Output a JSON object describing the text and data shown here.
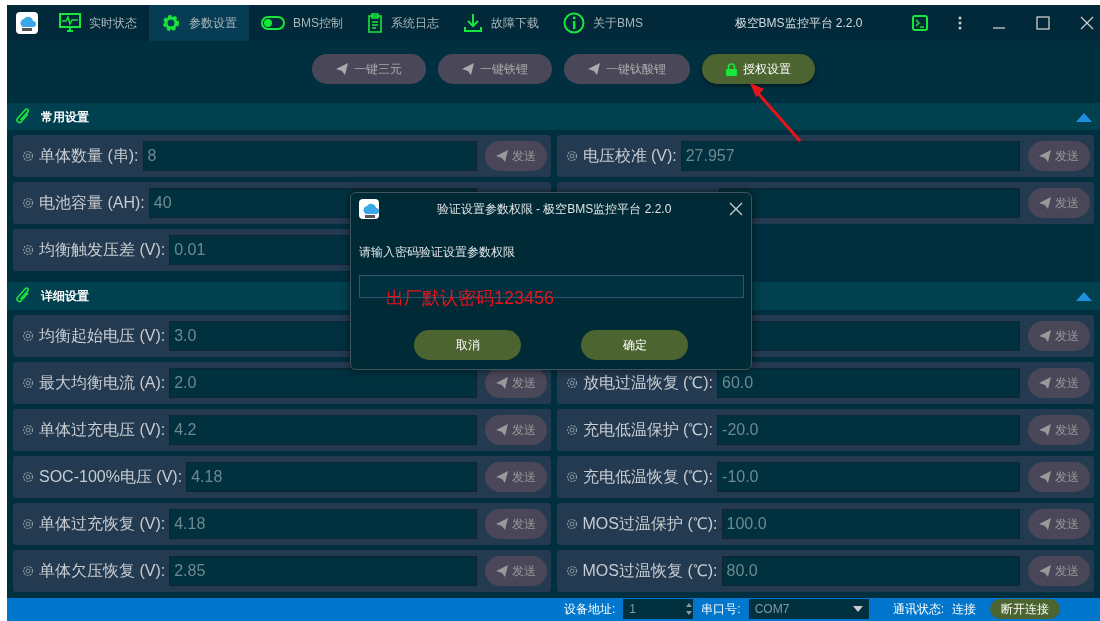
{
  "window": {
    "title": "极空BMS监控平台 2.2.0"
  },
  "tabs": [
    {
      "label": "实时状态",
      "selected": false
    },
    {
      "label": "参数设置",
      "selected": true
    },
    {
      "label": "BMS控制",
      "selected": false
    },
    {
      "label": "系统日志",
      "selected": false
    },
    {
      "label": "故障下载",
      "selected": false
    },
    {
      "label": "关于BMS",
      "selected": false
    }
  ],
  "toolbar": [
    {
      "label": "一键三元",
      "kind": "preset"
    },
    {
      "label": "一键铁锂",
      "kind": "preset"
    },
    {
      "label": "一键钛酸锂",
      "kind": "preset"
    },
    {
      "label": "授权设置",
      "kind": "auth"
    }
  ],
  "sections": [
    {
      "title": "常用设置",
      "expanded": true,
      "columns": [
        [
          {
            "label": "单体数量 (串):",
            "value": "8",
            "send": "发送"
          },
          {
            "label": "电池容量 (AH):",
            "value": "40"
          },
          {
            "label": "均衡触发压差 (V):",
            "value": "0.01"
          }
        ],
        [
          {
            "label": "电压校准 (V):",
            "value": "27.957",
            "send": "发送"
          },
          {
            "send": "发送"
          }
        ]
      ]
    },
    {
      "title": "详细设置",
      "expanded": true,
      "columns": [
        [
          {
            "label": "均衡起始电压 (V):",
            "value": "3.0"
          },
          {
            "label": "最大均衡电流 (A):",
            "value": "2.0",
            "send": "发送"
          },
          {
            "label": "单体过充电压 (V):",
            "value": "4.2",
            "send": "发送"
          },
          {
            "label": "SOC-100%电压 (V):",
            "value": "4.18",
            "send": "发送"
          },
          {
            "label": "单体过充恢复 (V):",
            "value": "4.18",
            "send": "发送"
          },
          {
            "label": "单体欠压恢复 (V):",
            "value": "2.85",
            "send": "发送"
          }
        ],
        [
          {
            "send": "发送"
          },
          {
            "label": "放电过温恢复 (℃):",
            "value": "60.0",
            "send": "发送"
          },
          {
            "label": "充电低温保护 (℃):",
            "value": "-20.0",
            "send": "发送"
          },
          {
            "label": "充电低温恢复 (℃):",
            "value": "-10.0",
            "send": "发送"
          },
          {
            "label": "MOS过温保护 (℃):",
            "value": "100.0",
            "send": "发送"
          },
          {
            "label": "MOS过温恢复 (℃):",
            "value": "80.0",
            "send": "发送"
          }
        ]
      ]
    }
  ],
  "dialog": {
    "title": "验证设置参数权限 - 极空BMS监控平台 2.2.0",
    "prompt": "请输入密码验证设置参数权限",
    "buttons": [
      "取消",
      "确定"
    ]
  },
  "annotation": {
    "text": "出厂默认密码123456"
  },
  "status_bar": {
    "address_label": "设备地址:",
    "address": "1",
    "port_label": "串口号:",
    "port": "COM7",
    "status_label": "通讯状态:",
    "status": "连接",
    "disconnect": "断开连接"
  }
}
